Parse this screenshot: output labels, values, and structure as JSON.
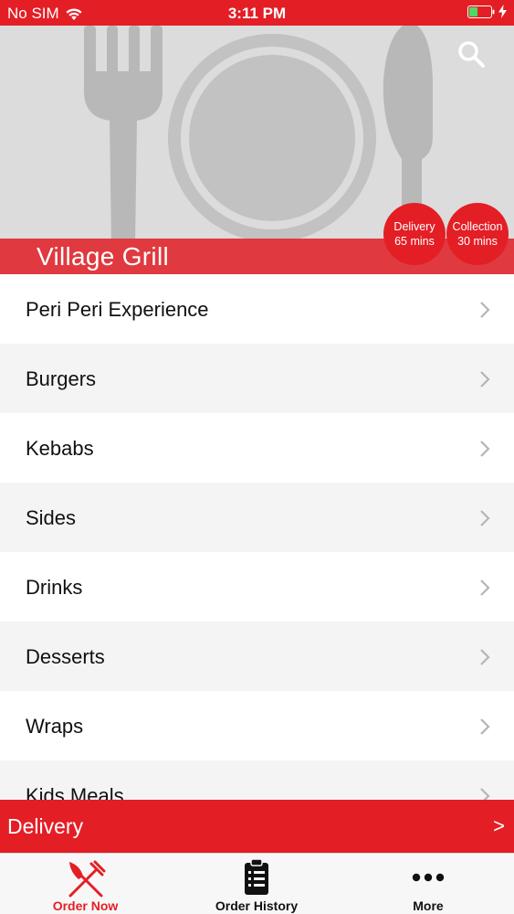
{
  "status_bar": {
    "carrier": "No SIM",
    "time": "3:11 PM"
  },
  "header": {
    "restaurant_name": "Village Grill",
    "search_icon": "search-icon",
    "delivery_badge": {
      "label": "Delivery",
      "time": "65 mins"
    },
    "collection_badge": {
      "label": "Collection",
      "time": "30 mins"
    }
  },
  "menu": {
    "categories": [
      {
        "label": "Peri Peri Experience"
      },
      {
        "label": "Burgers"
      },
      {
        "label": "Kebabs"
      },
      {
        "label": "Sides"
      },
      {
        "label": "Drinks"
      },
      {
        "label": "Desserts"
      },
      {
        "label": "Wraps"
      },
      {
        "label": "Kids Meals"
      }
    ]
  },
  "order_mode_bar": {
    "label": "Delivery",
    "arrow": ">"
  },
  "tabs": [
    {
      "label": "Order Now",
      "icon": "fork-knife-icon",
      "active": true
    },
    {
      "label": "Order History",
      "icon": "clipboard-list-icon",
      "active": false
    },
    {
      "label": "More",
      "icon": "more-dots-icon",
      "active": false
    }
  ],
  "colors": {
    "accent": "#e41e25",
    "title_band": "#e0393f",
    "hero_bg": "#dcdcdc",
    "hero_art": "#b8b8b8"
  }
}
